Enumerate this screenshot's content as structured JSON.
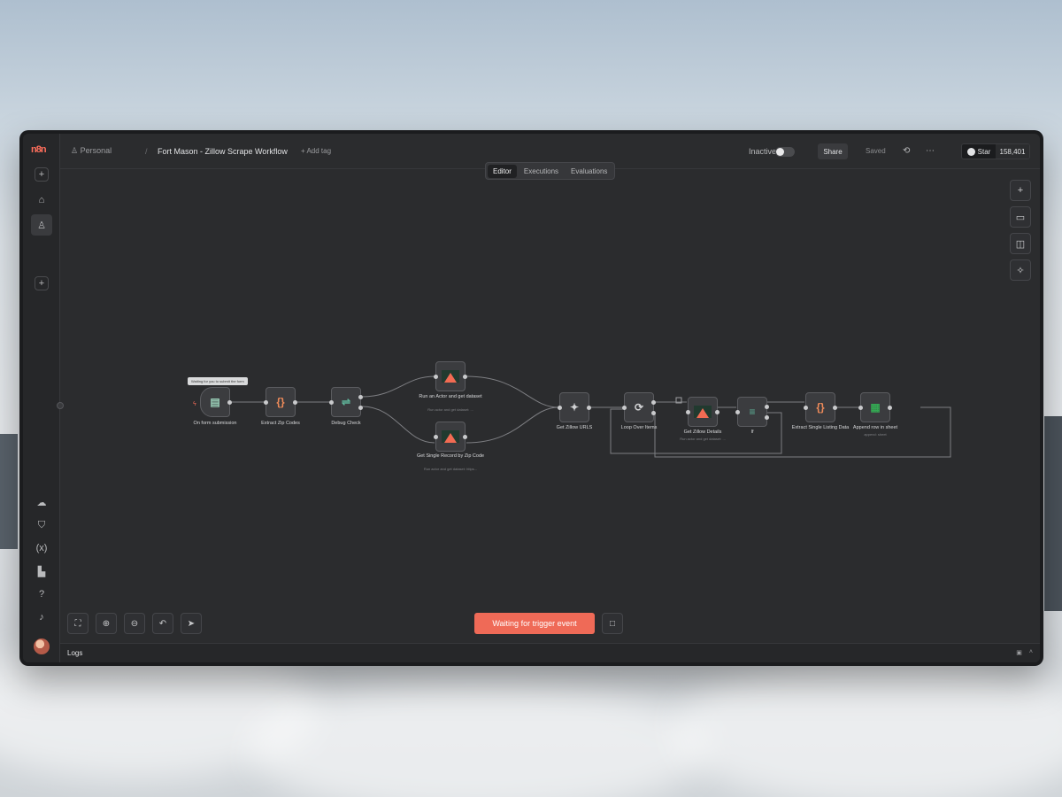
{
  "app": {
    "brand": "n8n",
    "breadcrumb_project": "Personal",
    "breadcrumb_sep": "/",
    "workflow_name": "Fort Mason - Zillow Scrape Workflow",
    "add_tag": "+ Add tag"
  },
  "header": {
    "status_label": "Inactive",
    "share_label": "Share",
    "saved_label": "Saved",
    "star_label": "Star",
    "star_count": "158,401"
  },
  "tabs": [
    {
      "label": "Editor",
      "active": true
    },
    {
      "label": "Executions",
      "active": false
    },
    {
      "label": "Evaluations",
      "active": false
    }
  ],
  "sidebar": {
    "top_icons": [
      "add-icon",
      "home-icon",
      "user-icon",
      "add-project-icon"
    ],
    "bottom_icons": [
      "cloud-icon",
      "templates-icon",
      "variables-icon",
      "insights-icon",
      "help-icon",
      "notifications-icon"
    ]
  },
  "canvas": {
    "tooltip": "Waiting for you to submit the form",
    "nodes": [
      {
        "id": "form",
        "label": "On form submission",
        "sub": "",
        "icon": "form-icon"
      },
      {
        "id": "zip",
        "label": "Extract Zip Codes",
        "sub": "",
        "icon": "code-icon"
      },
      {
        "id": "debug",
        "label": "Debug Check",
        "sub": "",
        "icon": "switch-icon"
      },
      {
        "id": "actor",
        "label": "Run an Actor and get dataset",
        "sub": "Run actor and get dataset: ...",
        "icon": "apify-icon"
      },
      {
        "id": "single",
        "label": "Get Single Record by Zip Code",
        "sub": "Run actor and get dataset: https...",
        "icon": "apify-icon"
      },
      {
        "id": "urls",
        "label": "Get Zillow URLS",
        "sub": "",
        "icon": "ai-icon"
      },
      {
        "id": "loop",
        "label": "Loop Over Items",
        "sub": "",
        "icon": "loop-icon"
      },
      {
        "id": "details",
        "label": "Get Zillow Details",
        "sub": "Run actor and get dataset: ...",
        "icon": "apify-icon"
      },
      {
        "id": "if",
        "label": "If",
        "sub": "",
        "icon": "if-icon"
      },
      {
        "id": "extract",
        "label": "Extract Single Listing Data",
        "sub": "",
        "icon": "code-icon"
      },
      {
        "id": "append",
        "label": "Append row in sheet",
        "sub": "append: sheet",
        "icon": "sheets-icon"
      }
    ],
    "port_labels": {
      "loop_done": "done",
      "loop_loop": "loop",
      "if_true": "true",
      "if_false": "false",
      "debug_a": "",
      "debug_b": ""
    }
  },
  "canvas_tools": [
    "fit-view-icon",
    "zoom-in-icon",
    "zoom-out-icon",
    "undo-icon",
    "select-icon"
  ],
  "right_tools": [
    "add-node-icon",
    "sticky-note-icon",
    "panel-icon",
    "ai-assistant-icon"
  ],
  "execute": {
    "label": "Waiting for trigger event"
  },
  "logs": {
    "label": "Logs"
  }
}
